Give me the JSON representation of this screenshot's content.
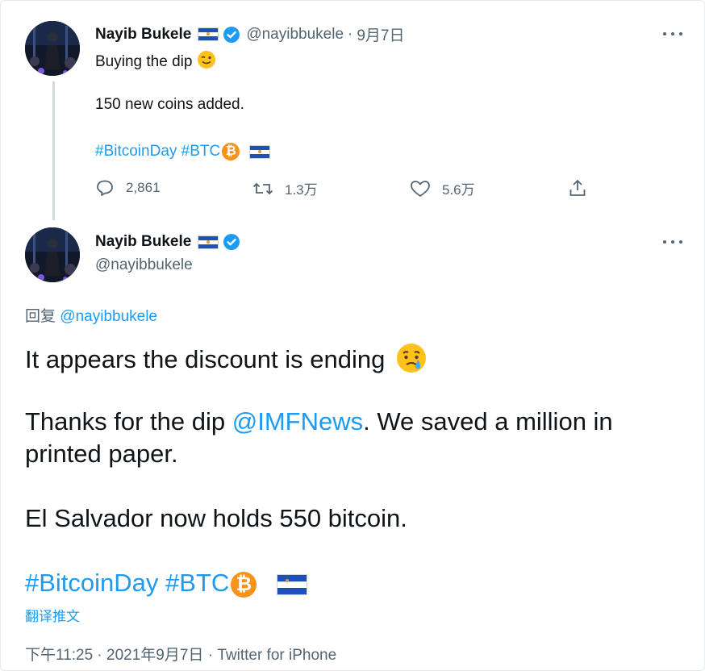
{
  "tweet1": {
    "name": "Nayib Bukele",
    "handle": "@nayibbukele",
    "separator": "·",
    "date": "9月7日",
    "line1": "Buying the dip",
    "line2": "150 new coins added.",
    "hashtag1": "#BitcoinDay",
    "hashtag2": "#BTC",
    "actions": {
      "reply_count": "2,861",
      "retweet_count": "1.3万",
      "like_count": "5.6万"
    }
  },
  "tweet2": {
    "name": "Nayib Bukele",
    "handle": "@nayibbukele",
    "reply_label": "回复",
    "reply_handle": "@nayibbukele",
    "line1": "It appears the discount is ending",
    "line2a": "Thanks for the dip ",
    "mention": "@IMFNews",
    "line2b": ". We saved a million in",
    "line3": "printed paper.",
    "line4": "El Salvador now holds 550 bitcoin.",
    "hashtag1": "#BitcoinDay",
    "hashtag2": "#BTC",
    "translate": "翻译推文",
    "time": "下午11:25",
    "date": "2021年9月7日",
    "source": "Twitter for iPhone",
    "separator": "·"
  },
  "icons": {
    "btc_symbol": "₿",
    "verified": "verified-badge-icon",
    "flag": "el-salvador-flag-icon"
  },
  "colors": {
    "link": "#1d9bf0",
    "verified": "#1d9bf0",
    "bitcoin": "#f7931a",
    "secondary_text": "#536471"
  }
}
